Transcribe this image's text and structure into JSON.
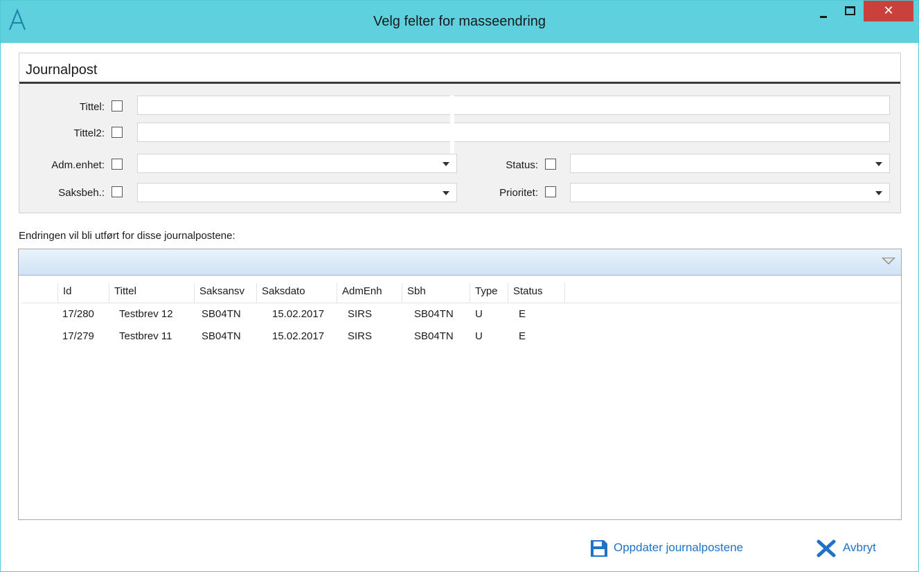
{
  "window": {
    "title": "Velg felter for masseendring",
    "close_glyph": "✕",
    "accent": "#5ed0de",
    "close_color": "#c9413a"
  },
  "journalpost": {
    "heading": "Journalpost",
    "fields": {
      "tittel": {
        "label": "Tittel:",
        "value": ""
      },
      "tittel2": {
        "label": "Tittel2:",
        "value": ""
      },
      "adm_enhet": {
        "label": "Adm.enhet:",
        "value": ""
      },
      "saksbeh": {
        "label": "Saksbeh.:",
        "value": ""
      },
      "status": {
        "label": "Status:",
        "value": ""
      },
      "prioritet": {
        "label": "Prioritet:",
        "value": ""
      }
    }
  },
  "info_text": "Endringen vil bli utført for disse journalpostene:",
  "grid": {
    "columns": [
      "Id",
      "Tittel",
      "Saksansv",
      "Saksdato",
      "AdmEnh",
      "Sbh",
      "Type",
      "Status"
    ],
    "rows": [
      [
        "17/280",
        "Testbrev 12",
        "SB04TN",
        "15.02.2017",
        "SIRS",
        "SB04TN",
        "U",
        "E"
      ],
      [
        "17/279",
        "Testbrev 11",
        "SB04TN",
        "15.02.2017",
        "SIRS",
        "SB04TN",
        "U",
        "E"
      ]
    ]
  },
  "actions": {
    "update_label": "Oppdater journalpostene",
    "cancel_label": "Avbryt",
    "link_color": "#1e73c8"
  },
  "icons": {
    "app": "app-logo-icon",
    "save": "save-icon",
    "cancel": "close-x-icon",
    "grid_menu": "chevron-down-icon"
  }
}
